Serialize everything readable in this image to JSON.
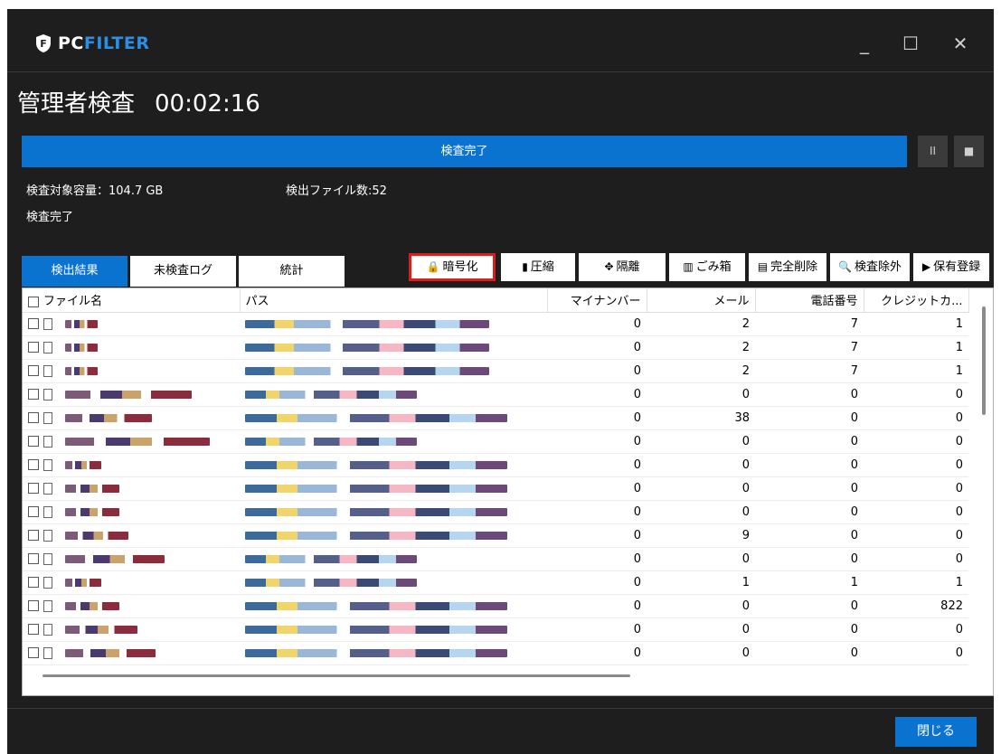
{
  "app": {
    "logo_pc": "PC",
    "logo_filter": "FILTER",
    "brand_color": "#2b8fe6",
    "accent_color": "#0a72cf"
  },
  "window_controls": {
    "minimize": "_",
    "maximize": "☐",
    "close": "✕"
  },
  "header": {
    "title": "管理者検査",
    "elapsed": "00:02:16"
  },
  "progress": {
    "label": "検査完了",
    "percent": 100,
    "pause": "II",
    "stop": "■"
  },
  "info": {
    "capacity": "検査対象容量：104.7 GB",
    "detected": "検出ファイル数:52",
    "status": "検査完了"
  },
  "tabs": [
    {
      "label": "検出結果",
      "active": true
    },
    {
      "label": "未検査ログ",
      "active": false
    },
    {
      "label": "統計",
      "active": false
    }
  ],
  "toolbar": [
    {
      "icon": "lock-icon",
      "glyph": "🔒",
      "label": "暗号化",
      "highlighted": true
    },
    {
      "icon": "compress-icon",
      "glyph": "▮",
      "label": "圧縮"
    },
    {
      "icon": "isolate-icon",
      "glyph": "✥",
      "label": "隔離"
    },
    {
      "icon": "trash-icon",
      "glyph": "▥",
      "label": "ごみ箱"
    },
    {
      "icon": "shred-icon",
      "glyph": "▤",
      "label": "完全削除"
    },
    {
      "icon": "exclude-icon",
      "glyph": "🔍",
      "label": "検査除外"
    },
    {
      "icon": "keep-icon",
      "glyph": "▶",
      "label": "保有登録"
    }
  ],
  "table": {
    "columns": [
      "ファイル名",
      "パス",
      "マイナンバー",
      "メール",
      "電話番号",
      "クレジットカ..."
    ],
    "rows": [
      [
        "0",
        "2",
        "7",
        "1"
      ],
      [
        "0",
        "2",
        "7",
        "1"
      ],
      [
        "0",
        "2",
        "7",
        "1"
      ],
      [
        "0",
        "0",
        "0",
        "0"
      ],
      [
        "0",
        "38",
        "0",
        "0"
      ],
      [
        "0",
        "0",
        "0",
        "0"
      ],
      [
        "0",
        "0",
        "0",
        "0"
      ],
      [
        "0",
        "0",
        "0",
        "0"
      ],
      [
        "0",
        "0",
        "0",
        "0"
      ],
      [
        "0",
        "9",
        "0",
        "0"
      ],
      [
        "0",
        "0",
        "0",
        "0"
      ],
      [
        "0",
        "1",
        "1",
        "1"
      ],
      [
        "0",
        "0",
        "0",
        "822"
      ],
      [
        "0",
        "0",
        "0",
        "0"
      ],
      [
        "0",
        "0",
        "0",
        "0"
      ]
    ]
  },
  "footer": {
    "close_label": "閉じる"
  }
}
